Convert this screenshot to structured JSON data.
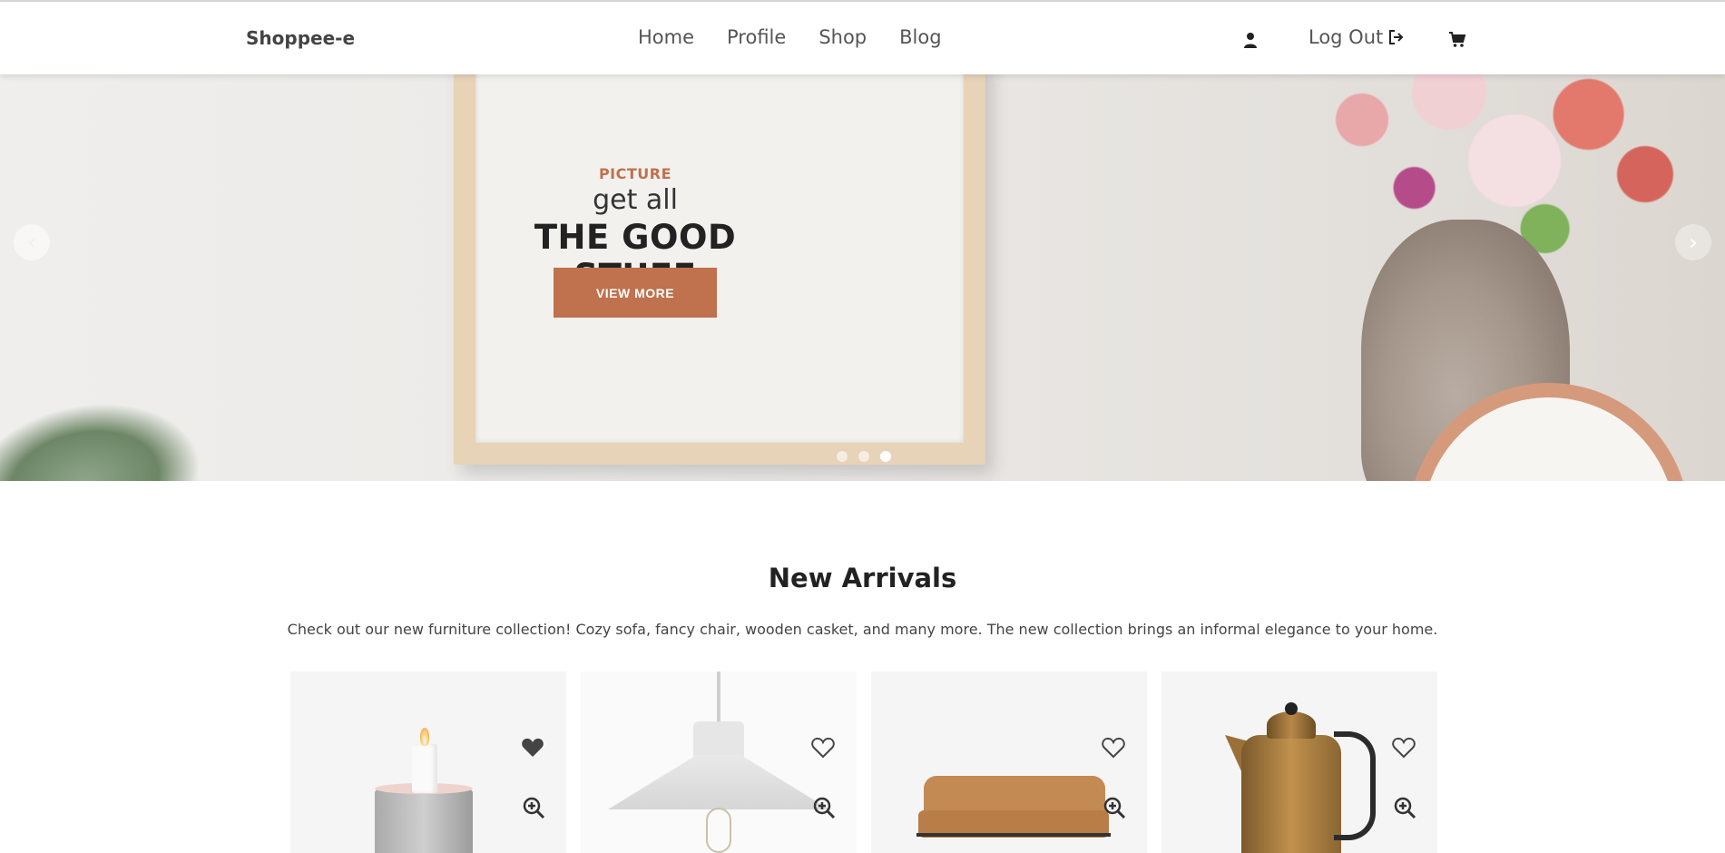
{
  "header": {
    "brand": "Shoppee-e",
    "nav": [
      "Home",
      "Profile",
      "Shop",
      "Blog"
    ],
    "user_icon": "user-icon",
    "logout_label": "Log Out",
    "logout_icon": "logout-icon",
    "cart_icon": "cart-icon"
  },
  "hero": {
    "eyebrow": "PICTURE",
    "subtitle": "get all",
    "title": "THE GOOD STUFF",
    "button_label": "VIEW MORE",
    "prev_icon": "chevron-left-icon",
    "next_icon": "chevron-right-icon",
    "slides_count": 3,
    "active_slide": 3
  },
  "new_arrivals": {
    "title": "New Arrivals",
    "description": "Check out our new furniture collection! Cozy sofa, fancy chair, wooden casket, and many more. The new collection brings an informal elegance to your home.",
    "products": [
      {
        "image": "candle",
        "favorited": true
      },
      {
        "image": "pendant-lamp",
        "favorited": false
      },
      {
        "image": "sofa",
        "favorited": false
      },
      {
        "image": "copper-pot",
        "favorited": false
      }
    ]
  },
  "colors": {
    "accent": "#c0714d",
    "text": "#222222",
    "muted": "#555555"
  }
}
